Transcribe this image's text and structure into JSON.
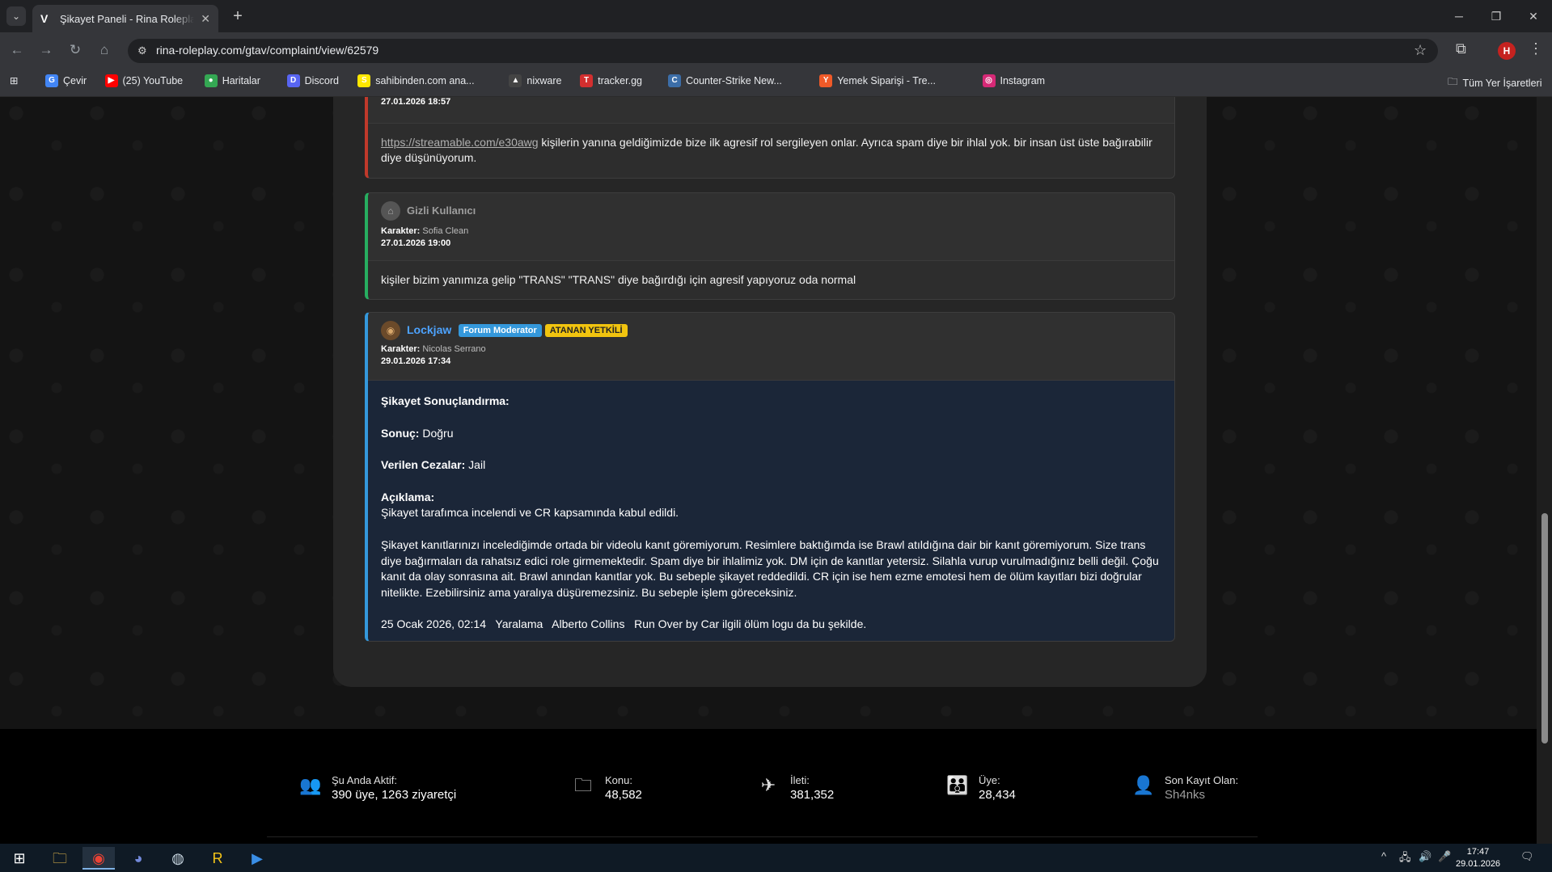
{
  "browser": {
    "tab_title": "Şikayet Paneli - Rina Roleplay G",
    "url": "rina-roleplay.com/gtav/complaint/view/62579",
    "profile_initial": "H",
    "bookmarks": [
      {
        "label": "Çevir",
        "color": "#4285f4",
        "glyph": "G"
      },
      {
        "label": "(25) YouTube",
        "color": "#ff0000",
        "glyph": "▶"
      },
      {
        "label": "Haritalar",
        "color": "#34a853",
        "glyph": "●"
      },
      {
        "label": "Discord",
        "color": "#5865f2",
        "glyph": "D"
      },
      {
        "label": "sahibinden.com ana...",
        "color": "#ffe800",
        "glyph": "S"
      },
      {
        "label": "nixware",
        "color": "#444444",
        "glyph": "▲"
      },
      {
        "label": "tracker.gg",
        "color": "#d32f2f",
        "glyph": "T"
      },
      {
        "label": "Counter-Strike New...",
        "color": "#3c6ea8",
        "glyph": "C"
      },
      {
        "label": "Yemek Siparişi - Tre...",
        "color": "#f05a28",
        "glyph": "Y"
      },
      {
        "label": "Instagram",
        "color": "#d62976",
        "glyph": "◎"
      }
    ],
    "all_bookmarks": "Tüm Yer İşaretleri"
  },
  "posts": {
    "first": {
      "date": "27.01.2026 18:57",
      "link": "https://streamable.com/e30awg",
      "text": " kişilerin yanına geldiğimizde bize ilk agresif rol sergileyen onlar. Ayrıca spam diye bir ihlal yok. bir insan üst üste bağırabilir diye düşünüyorum."
    },
    "second": {
      "user": "Gizli Kullanıcı",
      "char_label": "Karakter:",
      "char_name": "Sofia Clean",
      "date": "27.01.2026 19:00",
      "text": "kişiler bizim yanımıza gelip \"TRANS\" \"TRANS\" diye bağırdığı için agresif yapıyoruz oda normal"
    },
    "third": {
      "user": "Lockjaw",
      "badge_mod": "Forum Moderator",
      "badge_assigned": "ATANAN YETKİLİ",
      "char_label": "Karakter:",
      "char_name": "Nicolas Serrano",
      "date": "29.01.2026 17:34",
      "heading": "Şikayet Sonuçlandırma:",
      "result_label": "Sonuç:",
      "result_value": " Doğru",
      "penalty_label": "Verilen Cezalar:",
      "penalty_value": " Jail",
      "desc_label": "Açıklama:",
      "desc_line": "Şikayet tarafımca incelendi ve CR kapsamında kabul edildi.",
      "paragraph": "Şikayet kanıtlarınızı incelediğimde ortada bir videolu kanıt göremiyorum. Resimlere baktığımda ise Brawl atıldığına dair bir kanıt göremiyorum.  Size trans diye bağırmaları da rahatsız edici role girmemektedir. Spam diye bir ihlalimiz yok. DM için de kanıtlar yetersiz. Silahla vurup vurulmadığınız belli değil. Çoğu kanıt da olay sonrasına ait. Brawl anından kanıtlar yok. Bu sebeple şikayet reddedildi. CR için ise hem ezme emotesi hem de ölüm kayıtları bizi doğrular nitelikte. Ezebilirsiniz ama yaralıya düşüremezsiniz. Bu sebeple işlem göreceksiniz.",
      "log_line": "25 Ocak 2026, 02:14   Yaralama   Alberto Collins   Run Over by Car ilgili ölüm logu da bu şekilde."
    }
  },
  "footer": {
    "stats": [
      {
        "label": "Şu Anda Aktif:",
        "value": "390 üye, 1263 ziyaretçi",
        "icon": "users-icon"
      },
      {
        "label": "Konu:",
        "value": "48,582",
        "icon": "folder-icon"
      },
      {
        "label": "İleti:",
        "value": "381,352",
        "icon": "send-icon"
      },
      {
        "label": "Üye:",
        "value": "28,434",
        "icon": "group-icon"
      },
      {
        "label": "Son Kayıt Olan:",
        "value": "Sh4nks",
        "icon": "user-add-icon"
      }
    ]
  },
  "taskbar": {
    "time": "17:47",
    "date": "29.01.2026"
  }
}
